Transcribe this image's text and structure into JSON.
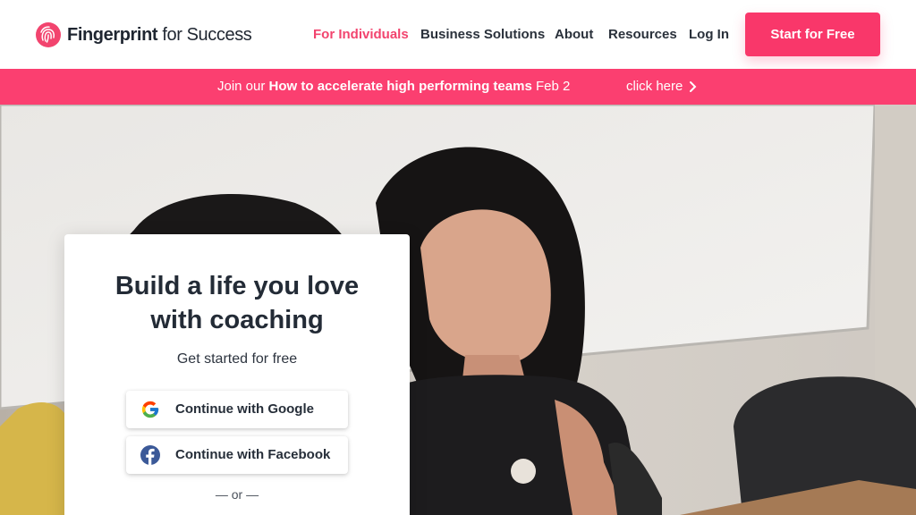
{
  "brand": {
    "name_bold": "Fingerprint",
    "name_rest": " for Success",
    "accent": "#f9376a",
    "logo_icon": "fingerprint-icon"
  },
  "nav": {
    "items": [
      {
        "label": "For Individuals",
        "active": true
      },
      {
        "label": "Business Solutions",
        "active": false
      },
      {
        "label": "About",
        "active": false
      },
      {
        "label": "Resources",
        "active": false
      },
      {
        "label": "Log In",
        "active": false
      }
    ],
    "cta": "Start for Free"
  },
  "banner": {
    "prefix": "Join our ",
    "event": "How to accelerate high performing teams",
    "date": " Feb 2",
    "link": "click here",
    "link_icon": "chevron-right-icon",
    "color": "#fb3f70"
  },
  "card": {
    "title_line1": "Build a life you love",
    "title_line2": "with coaching",
    "subtitle": "Get started for free",
    "google_label": "Continue with Google",
    "google_icon": "google-icon",
    "facebook_label": "Continue with Facebook",
    "facebook_icon": "facebook-icon",
    "divider": "— or —"
  }
}
